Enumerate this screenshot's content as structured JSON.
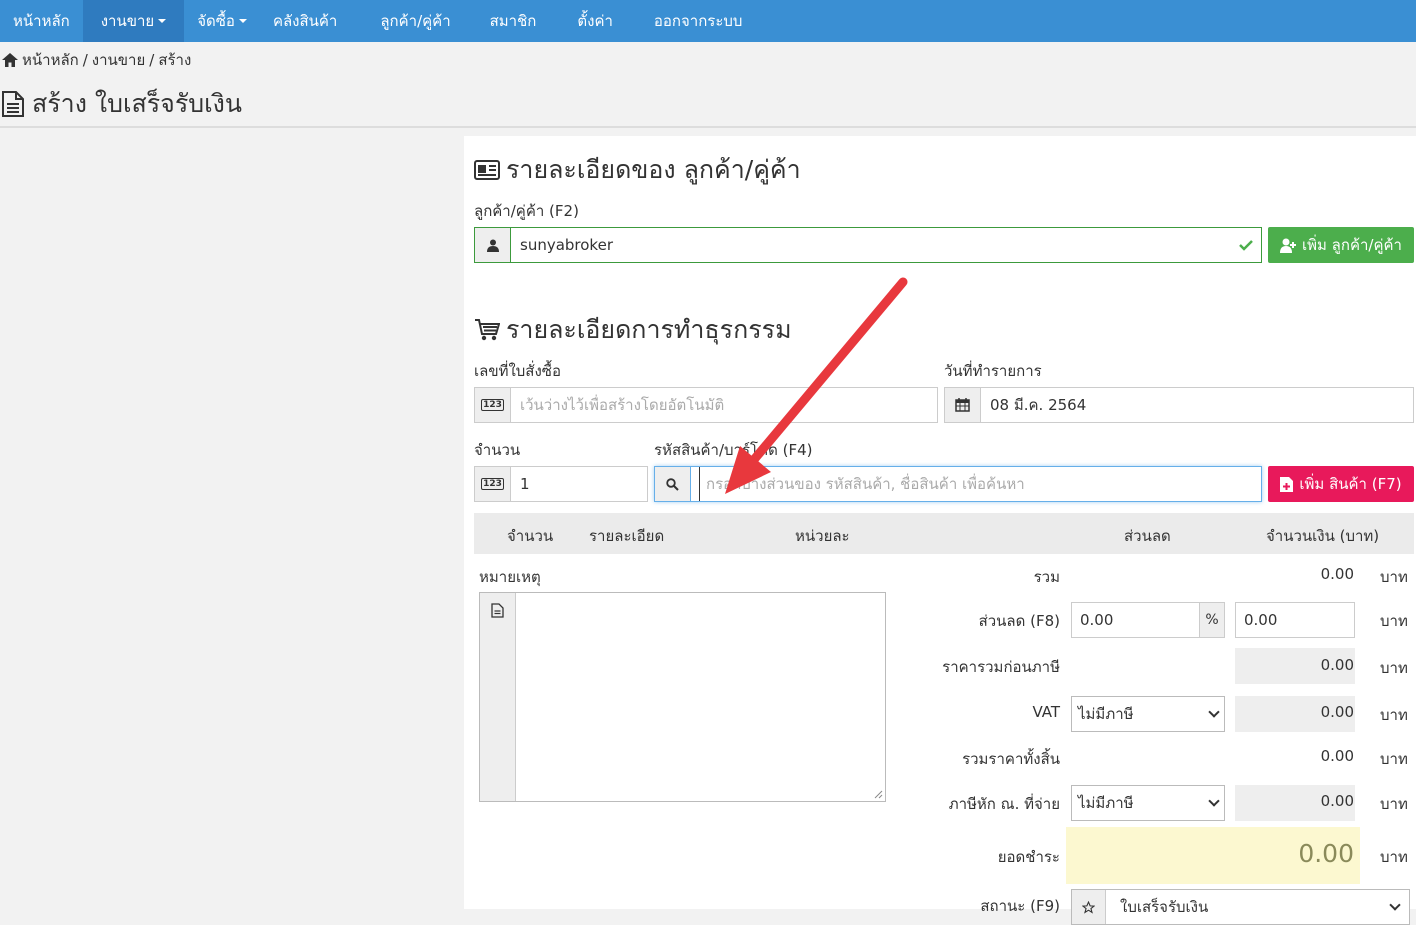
{
  "nav": {
    "home": "หน้าหลัก",
    "sales": "งานขาย",
    "purchase": "จัดซื้อ",
    "inventory": "คลังสินค้า",
    "customers": "ลูกค้า/คู่ค้า",
    "members": "สมาชิก",
    "settings": "ตั้งค่า",
    "logout": "ออกจากระบบ"
  },
  "breadcrumb": {
    "home": "หน้าหลัก",
    "sep1": "/",
    "sales": "งานขาย",
    "sep2": "/",
    "create": "สร้าง"
  },
  "page_title": "สร้าง ใบเสร็จรับเงิน",
  "customer_section": {
    "heading": "รายละเอียดของ ลูกค้า/คู่ค้า",
    "label": "ลูกค้า/คู่ค้า (F2)",
    "value": "sunyabroker",
    "add_button": "เพิ่ม ลูกค้า/คู่ค้า"
  },
  "transaction_section": {
    "heading": "รายละเอียดการทำธุรกรรม",
    "order_no_label": "เลขที่ใบสั่งซื้อ",
    "order_no_placeholder": "เว้นว่างไว้เพื่อสร้างโดยอัตโนมัติ",
    "date_label": "วันที่ทำรายการ",
    "date_value": "08 มี.ค. 2564",
    "qty_label": "จำนวน",
    "qty_value": "1",
    "product_label": "รหัสสินค้า/บาร์โค้ด (F4)",
    "product_placeholder": "กรอกบางส่วนของ รหัสสินค้า, ชื่อสินค้า เพื่อค้นหา",
    "add_product_button": "เพิ่ม สินค้า (F7)"
  },
  "table": {
    "headers": [
      "จำนวน",
      "รายละเอียด",
      "หน่วยละ",
      "ส่วนลด",
      "จำนวนเงิน (บาท)"
    ]
  },
  "notes_label": "หมายเหตุ",
  "summary": {
    "total_label": "รวม",
    "total_value": "0.00",
    "discount_label": "ส่วนลด (F8)",
    "discount_percent_value": "0.00",
    "percent_symbol": "%",
    "discount_amount_value": "0.00",
    "pretax_label": "ราคารวมก่อนภาษี",
    "pretax_value": "0.00",
    "vat_label": "VAT",
    "vat_option": "ไม่มีภาษี",
    "vat_value": "0.00",
    "grand_label": "รวมราคาทั้งสิ้น",
    "grand_value": "0.00",
    "wht_label": "ภาษีหัก ณ. ที่จ่าย",
    "wht_option": "ไม่มีภาษี",
    "wht_value": "0.00",
    "due_label": "ยอดชำระ",
    "due_value": "0.00",
    "status_label": "สถานะ (F9)",
    "status_option": "ใบเสร็จรับเงิน",
    "currency": "บาท"
  },
  "colors": {
    "nav_bg": "#3a8fd3",
    "success": "#4cae4c",
    "danger": "#e8195b",
    "due_bg": "#fcf8d0",
    "arrow": "#e8383d"
  }
}
